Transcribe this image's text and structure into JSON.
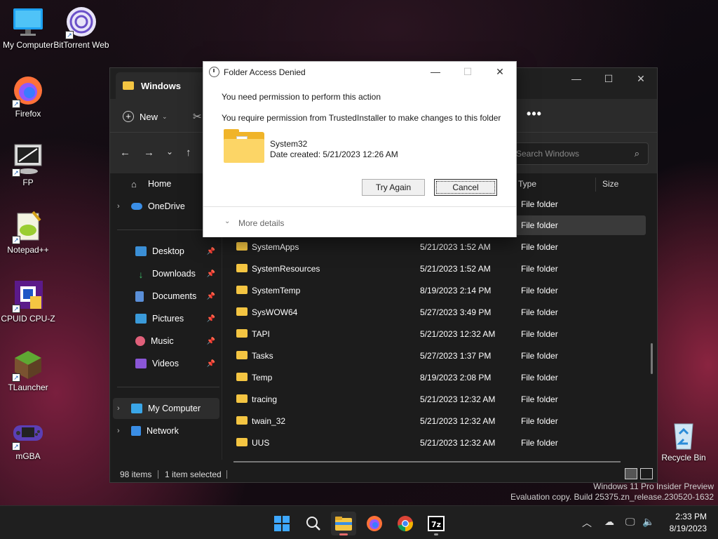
{
  "desktop": {
    "icons": [
      {
        "label": "My Computer"
      },
      {
        "label": "BitTorrent Web"
      },
      {
        "label": "Firefox"
      },
      {
        "label": "FP"
      },
      {
        "label": "Notepad++"
      },
      {
        "label": "CPUID CPU-Z"
      },
      {
        "label": "TLauncher"
      },
      {
        "label": "mGBA"
      },
      {
        "label": "Recycle Bin"
      }
    ],
    "watermark": {
      "line1": "Windows 11 Pro Insider Preview",
      "line2": "Evaluation copy. Build 25375.zn_release.230520-1632"
    }
  },
  "explorer": {
    "tab_title": "Windows",
    "new_label": "New",
    "search_placeholder": "Search Windows",
    "more_label": "•••",
    "sidebar": {
      "home": "Home",
      "onedrive": "OneDrive",
      "quick": [
        "Desktop",
        "Downloads",
        "Documents",
        "Pictures",
        "Music",
        "Videos"
      ],
      "my_computer": "My Computer",
      "network": "Network"
    },
    "columns": {
      "type": "Type",
      "size": "Size"
    },
    "rows": [
      {
        "name": "",
        "date": "",
        "type": "File folder"
      },
      {
        "name": "",
        "date": "",
        "type": "File folder"
      },
      {
        "name": "SystemApps",
        "date": "5/21/2023 1:52 AM",
        "type": "File folder"
      },
      {
        "name": "SystemResources",
        "date": "5/21/2023 1:52 AM",
        "type": "File folder"
      },
      {
        "name": "SystemTemp",
        "date": "8/19/2023 2:14 PM",
        "type": "File folder"
      },
      {
        "name": "SysWOW64",
        "date": "5/27/2023 3:49 PM",
        "type": "File folder"
      },
      {
        "name": "TAPI",
        "date": "5/21/2023 12:32 AM",
        "type": "File folder"
      },
      {
        "name": "Tasks",
        "date": "5/27/2023 1:37 PM",
        "type": "File folder"
      },
      {
        "name": "Temp",
        "date": "8/19/2023 2:08 PM",
        "type": "File folder"
      },
      {
        "name": "tracing",
        "date": "5/21/2023 12:32 AM",
        "type": "File folder"
      },
      {
        "name": "twain_32",
        "date": "5/21/2023 12:32 AM",
        "type": "File folder"
      },
      {
        "name": "UUS",
        "date": "5/21/2023 12:32 AM",
        "type": "File folder"
      }
    ],
    "status": {
      "count": "98 items",
      "selected": "1 item selected"
    }
  },
  "dialog": {
    "title": "Folder Access Denied",
    "message1": "You need permission to perform this action",
    "message2": "You require permission from TrustedInstaller to make changes to this folder",
    "item_name": "System32",
    "item_date": "Date created: 5/21/2023 12:26 AM",
    "try_again": "Try Again",
    "cancel": "Cancel",
    "more_details": "More details"
  },
  "taskbar": {
    "time": "2:33 PM",
    "date": "8/19/2023"
  },
  "colors": {
    "folder": "#f4c542",
    "accent": "#0078d4"
  }
}
